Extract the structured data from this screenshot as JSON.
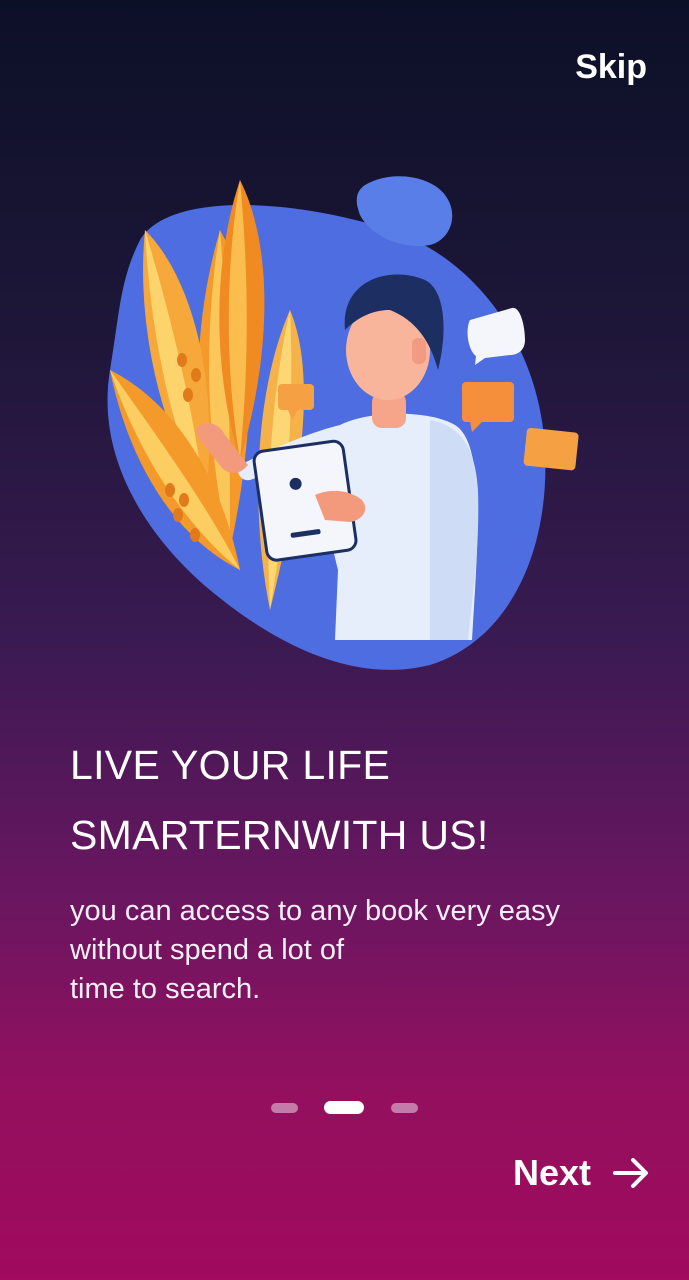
{
  "header": {
    "skip_label": "Skip"
  },
  "illustration": {
    "icon": "person-with-tablet-illustration"
  },
  "onboarding": {
    "headline_lines": [
      "LIVE YOUR LIFE",
      "SMARTERNWITH US!"
    ],
    "body_lines": [
      "you can access to any book very easy",
      "without spend a lot of",
      "time to search."
    ]
  },
  "pager": {
    "total": 3,
    "active_index": 1
  },
  "footer": {
    "next_label": "Next",
    "next_icon": "arrow-right-icon"
  },
  "colors": {
    "gradient_top": "#0c1027",
    "gradient_bottom": "#a10a5e",
    "blob": "#4f6fe0",
    "leaf_orange": "#f39a2a",
    "leaf_yellow": "#fbcf63"
  }
}
